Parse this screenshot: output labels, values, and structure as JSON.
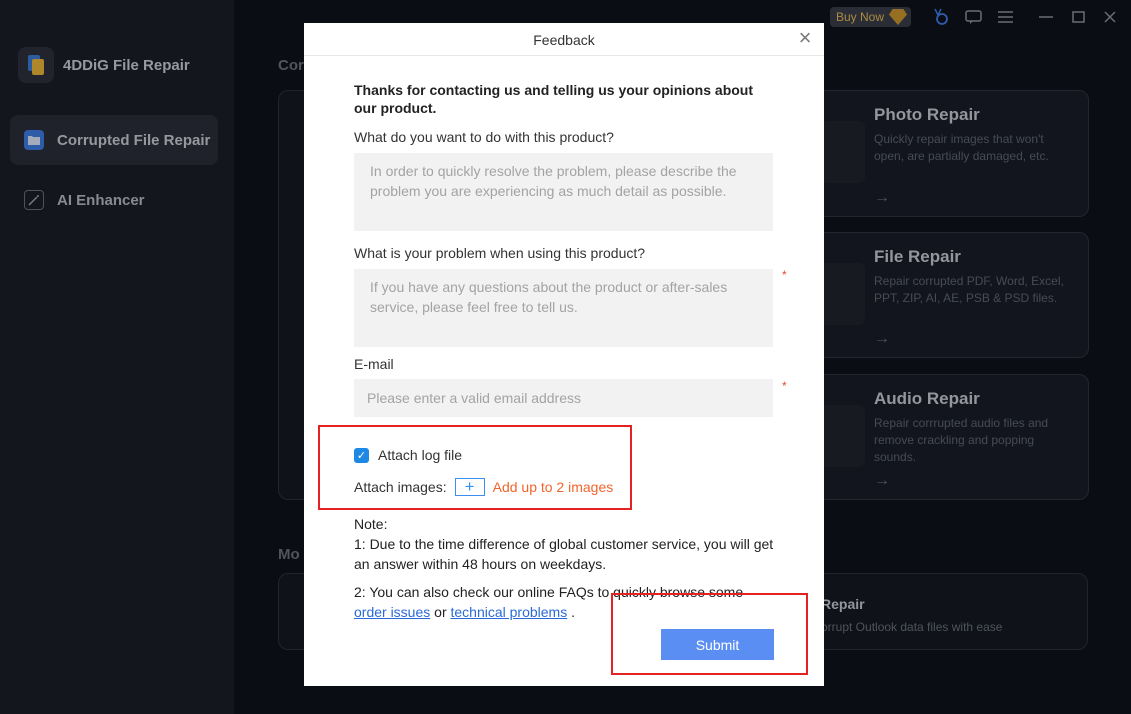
{
  "app": {
    "brand_name": "4DDiG File Repair",
    "nav": [
      {
        "label": "Corrupted File Repair",
        "active": true
      },
      {
        "label": "AI Enhancer",
        "active": false
      }
    ],
    "topbar": {
      "buy_now": "Buy Now"
    },
    "section_titles": [
      "Cor",
      "Mo"
    ],
    "cards": [
      {
        "title": "Photo Repair",
        "desc": "Quickly repair images that won't open, are partially damaged, etc.",
        "arrow": "→"
      },
      {
        "title": "File Repair",
        "desc": "Repair corrupted PDF, Word, Excel, PPT, ZIP, AI, AE, PSB & PSD files.",
        "arrow": "→"
      },
      {
        "title": "Audio Repair",
        "desc": "Repair corrrupted audio files and remove crackling and popping sounds.",
        "arrow": "→"
      }
    ],
    "outlook_card": {
      "title": "Repair",
      "desc": "orrupt Outlook data files with ease"
    }
  },
  "dialog": {
    "title": "Feedback",
    "close_icon": "×",
    "intro": "Thanks for contacting us and telling us your opinions about our product.",
    "q1_label": "What do you want to do with this product?",
    "q1_placeholder": "In order to quickly resolve the problem, please describe the problem you are experiencing as much detail as possible.",
    "q2_label": "What is your problem when using this product?",
    "q2_placeholder": "If you have any questions about the product or after-sales service, please feel free to tell us.",
    "required_mark": "*",
    "email_label": "E-mail",
    "email_placeholder": "Please enter a valid email address",
    "attach_log_label": "Attach log file",
    "attach_log_checked": true,
    "checkmark": "✓",
    "attach_images_label": "Attach images:",
    "plus_symbol": "+",
    "add_images_text": "Add up to 2 images",
    "note_title": "Note:",
    "note_1": "1: Due to the time difference of global customer service, you will get an answer within 48 hours on weekdays.",
    "note_2_prefix": "2: You can also check our online FAQs to quickly browse some",
    "link_order": "order issues",
    "note_or": "or",
    "link_technical": "technical problems",
    "note_end": ".",
    "submit_label": "Submit"
  },
  "colors": {
    "accent_blue": "#5b8ef2",
    "checkbox_blue": "#1e88e5",
    "orange_link": "#f0652c",
    "annotation_red": "#e42222"
  }
}
